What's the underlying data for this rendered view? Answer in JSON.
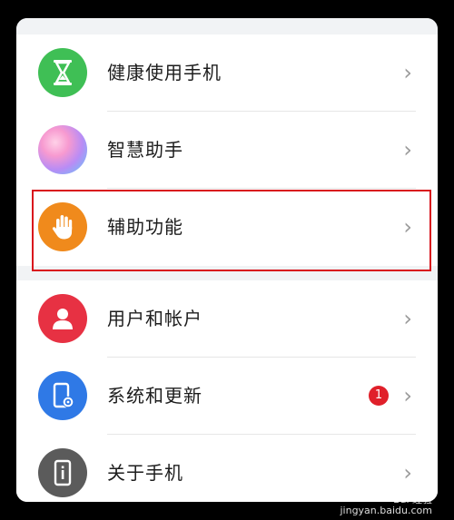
{
  "settings": {
    "items": [
      {
        "label": "健康使用手机",
        "icon": "hourglass-icon",
        "color": "#3fbf55"
      },
      {
        "label": "智慧助手",
        "icon": "gradient-orb-icon",
        "color": "#c78cf0"
      },
      {
        "label": "辅助功能",
        "icon": "hand-icon",
        "color": "#f08a1c"
      },
      {
        "label": "用户和帐户",
        "icon": "user-icon",
        "color": "#e73143"
      },
      {
        "label": "系统和更新",
        "icon": "phone-gear-icon",
        "color": "#2f79e6",
        "badge": "1"
      },
      {
        "label": "关于手机",
        "icon": "phone-info-icon",
        "color": "#5b5b5b"
      }
    ]
  },
  "watermark": {
    "brand": "Bai 经验",
    "url": "jingyan.baidu.com"
  }
}
